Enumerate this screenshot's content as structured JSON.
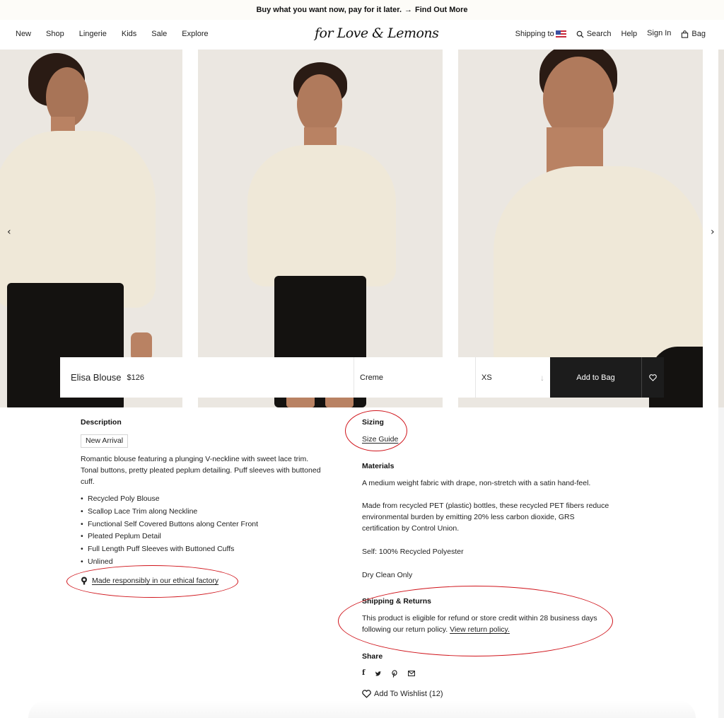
{
  "promo": {
    "text": "Buy what you want now, pay for it later.",
    "arrow": "→",
    "link": "Find Out More"
  },
  "nav": {
    "items": [
      "New",
      "Shop",
      "Lingerie",
      "Kids",
      "Sale",
      "Explore"
    ],
    "logo": "for Love & Lemons",
    "shipping_label": "Shipping to",
    "shipping_country": "United States",
    "search": "Search",
    "help": "Help",
    "sign_in": "Sign In",
    "bag": "Bag"
  },
  "gallery": {
    "prev_icon": "‹",
    "next_icon": "›"
  },
  "buybar": {
    "product_name": "Elisa Blouse",
    "price": "$126",
    "color": "Creme",
    "size": "XS",
    "size_icon": "↓",
    "add_to_bag": "Add to Bag"
  },
  "description": {
    "heading": "Description",
    "badge": "New Arrival",
    "text": "Romantic blouse featuring a plunging V-neckline with sweet lace trim. Tonal buttons, pretty pleated peplum detailing. Puff sleeves with buttoned cuff.",
    "features": [
      "Recycled Poly Blouse",
      "Scallop Lace Trim along Neckline",
      "Functional Self Covered Buttons along Center Front",
      "Pleated Peplum Detail",
      "Full Length Puff Sleeves with Buttoned Cuffs",
      "Unlined"
    ],
    "ethical_link": "Made responsibly in our ethical factory"
  },
  "sizing": {
    "heading": "Sizing",
    "link": "Size Guide"
  },
  "materials": {
    "heading": "Materials",
    "p1": "A medium weight fabric with drape, non-stretch with a satin hand-feel.",
    "p2": "Made from recycled PET (plastic) bottles, these recycled PET fibers reduce environmental burden by emitting 20% less carbon dioxide, GRS certification by Control Union.",
    "p3": "Self: 100% Recycled Polyester",
    "p4": "Dry Clean Only"
  },
  "shipping": {
    "heading": "Shipping & Returns",
    "text": "This product is eligible for refund or store credit within 28 business days following our return policy.",
    "link": "View return policy."
  },
  "share": {
    "heading": "Share",
    "icons": [
      "facebook",
      "twitter",
      "pinterest",
      "email"
    ]
  },
  "wishlist": {
    "label": "Add To Wishlist",
    "count": "(12)"
  },
  "colors": {
    "annotation": "#d0141b",
    "button_dark": "#1c1c1c",
    "promo_bg": "#fdfcf8"
  }
}
